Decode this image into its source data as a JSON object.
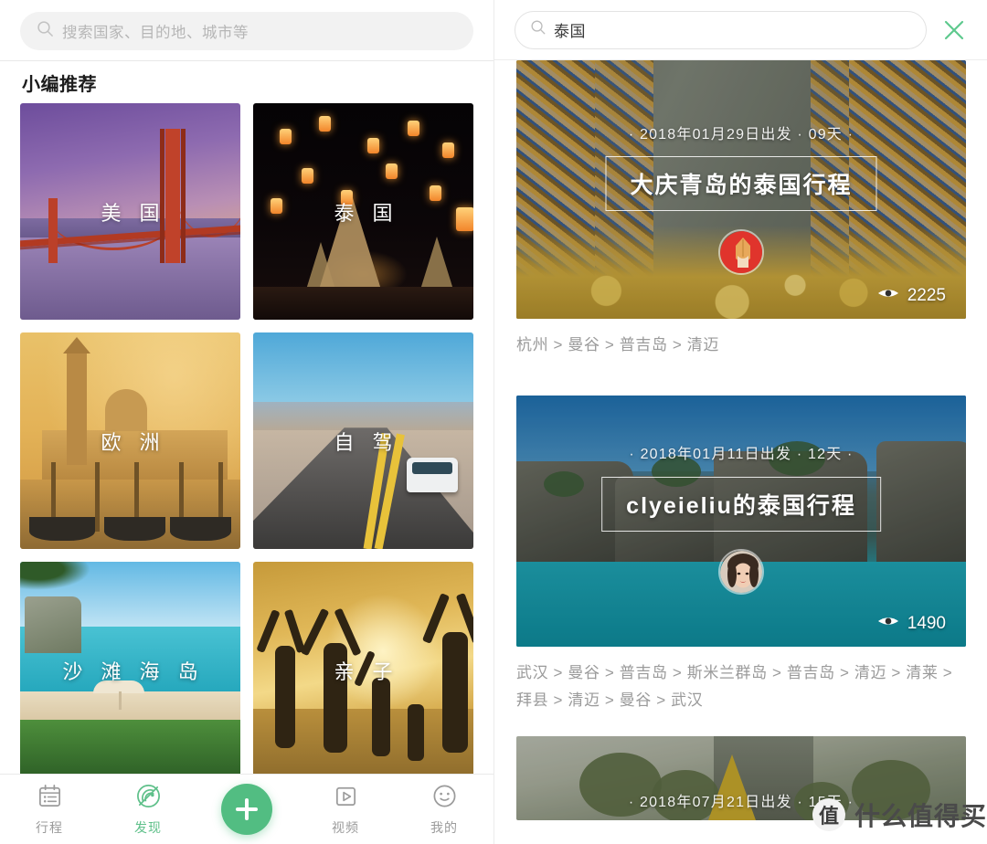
{
  "left": {
    "search": {
      "placeholder": "搜索国家、目的地、城市等",
      "icon": "search-icon"
    },
    "section_title": "小编推荐",
    "tiles": [
      {
        "label": "美 国",
        "art": "golden-gate-bridge"
      },
      {
        "label": "泰 国",
        "art": "thailand-lanterns"
      },
      {
        "label": "欧 洲",
        "art": "venice-gondolas"
      },
      {
        "label": "自 驾",
        "art": "desert-highway"
      },
      {
        "label": "沙 滩 海 岛",
        "art": "beach-island"
      },
      {
        "label": "亲 子",
        "art": "family-sunset"
      }
    ],
    "nav": [
      {
        "label": "行程",
        "icon": "calendar-icon",
        "active": false
      },
      {
        "label": "发现",
        "icon": "radar-icon",
        "active": true
      },
      {
        "label": "",
        "icon": "plus-icon",
        "active": false
      },
      {
        "label": "视频",
        "icon": "video-play-icon",
        "active": false
      },
      {
        "label": "我的",
        "icon": "smiley-face-icon",
        "active": false
      }
    ],
    "accent_color": "#52bd82"
  },
  "right": {
    "search": {
      "value": "泰国",
      "icon": "search-icon"
    },
    "close_label": "×",
    "close_color": "#5ec98e",
    "cards": [
      {
        "meta": "· 2018年01月29日出发 · 09天 ·",
        "title": "大庆青岛的泰国行程",
        "views": "2225",
        "views_icon": "eye-icon",
        "avatar": "red-warrior-avatar",
        "route": "杭州 > 曼谷 > 普吉岛 > 清迈"
      },
      {
        "meta": "· 2018年01月11日出发 · 12天 ·",
        "title": "clyeieliu的泰国行程",
        "views": "1490",
        "views_icon": "eye-icon",
        "avatar": "woman-photo-avatar",
        "route": "武汉 > 曼谷 > 普吉岛 > 斯米兰群岛 > 普吉岛 > 清迈 > 清莱 > 拜县 > 清迈 > 曼谷 > 武汉"
      },
      {
        "meta": "· 2018年07月21日出发 · 15天 ·",
        "title": "",
        "views": "",
        "views_icon": "eye-icon",
        "avatar": "",
        "route": ""
      }
    ],
    "watermark": {
      "badge": "值",
      "text": "什么值得买"
    }
  }
}
